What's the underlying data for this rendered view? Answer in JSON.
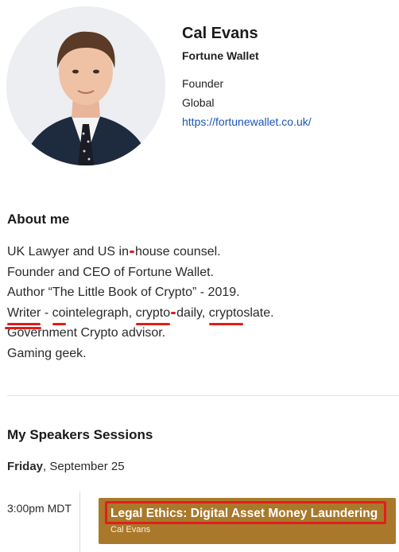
{
  "profile": {
    "name": "Cal Evans",
    "company": "Fortune Wallet",
    "role": "Founder",
    "location": "Global",
    "website": "https://fortunewallet.co.uk/"
  },
  "about": {
    "title": "About me",
    "line1_a": "UK Lawyer and US in",
    "line1_b": "house counsel.",
    "line2": "Founder and CEO of Fortune Wallet.",
    "line3": "Author “The Little Book of Crypto” - 2019.",
    "line4": {
      "writer": "Writer",
      "sep1": " - ",
      "co": "co",
      "intelegraph": "intelegraph, ",
      "crypto1": "crypto",
      "daily": "daily, ",
      "crypto2": "crypto",
      "slate": "slate."
    },
    "line5": "Government Crypto advisor.",
    "line6": "Gaming geek."
  },
  "sessions": {
    "title": "My Speakers Sessions",
    "day_bold": "Friday",
    "day_rest": ", September 25",
    "items": [
      {
        "time": "3:00pm MDT",
        "title": "Legal Ethics: Digital Asset Money Laundering",
        "speaker": "Cal Evans"
      }
    ]
  },
  "colors": {
    "session_card": "#a9782a",
    "highlight_border": "#e21e1e",
    "link": "#1a55b8",
    "spellcheck": "#e41b1b"
  }
}
